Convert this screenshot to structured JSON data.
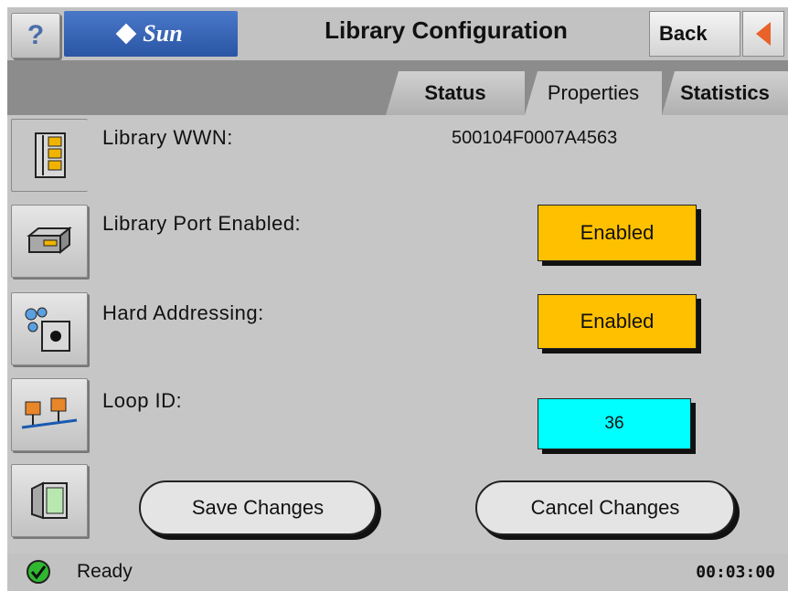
{
  "header": {
    "help_label": "?",
    "brand": "Sun",
    "title": "Library Configuration",
    "back_label": "Back"
  },
  "tabs": [
    {
      "label": "Status",
      "active": false
    },
    {
      "label": "Properties",
      "active": true
    },
    {
      "label": "Statistics",
      "active": false
    }
  ],
  "sidebar": {
    "items": [
      {
        "icon": "library-icon",
        "selected": true
      },
      {
        "icon": "drive-icon",
        "selected": false
      },
      {
        "icon": "device-icon",
        "selected": false
      },
      {
        "icon": "network-icon",
        "selected": false
      },
      {
        "icon": "display-icon",
        "selected": false
      }
    ]
  },
  "properties": {
    "wwn_label": "Library WWN:",
    "wwn_value": "500104F0007A4563",
    "port_label": "Library Port Enabled:",
    "port_value": "Enabled",
    "hard_label": "Hard Addressing:",
    "hard_value": "Enabled",
    "loop_label": "Loop ID:",
    "loop_value": "36"
  },
  "actions": {
    "save_label": "Save Changes",
    "cancel_label": "Cancel Changes"
  },
  "status": {
    "text": "Ready",
    "clock": "00:03:00"
  },
  "colors": {
    "enabled_bg": "#ffc000",
    "loop_bg": "#00ffff",
    "brand_blue": "#2a55a5",
    "back_arrow": "#e8622a",
    "ready_green": "#2fb82f"
  }
}
